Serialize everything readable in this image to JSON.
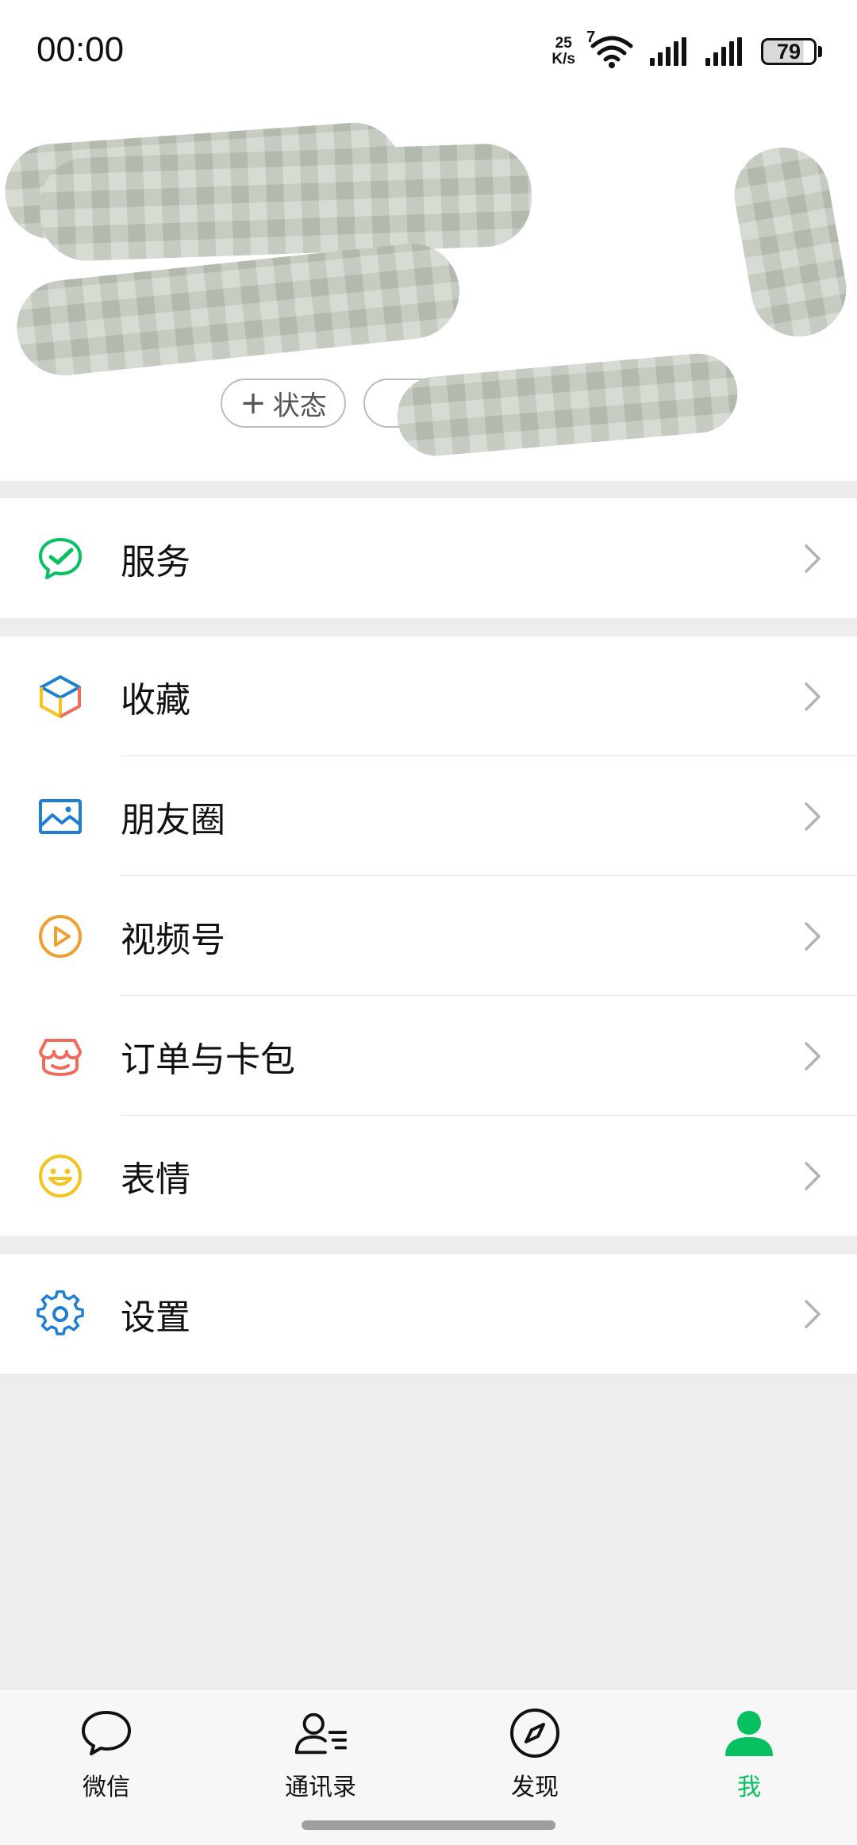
{
  "status_bar": {
    "time": "00:00",
    "net_speed_value": "25",
    "net_speed_unit": "K/s",
    "wifi_badge": "7",
    "battery_level": "79"
  },
  "profile": {
    "status_chip_label": "状态",
    "status_chip_icon": "plus-icon"
  },
  "menu": {
    "services": {
      "label": "服务",
      "icon": "services-icon",
      "color": "#07c160"
    },
    "favorites": {
      "label": "收藏",
      "icon": "cube-icon"
    },
    "moments": {
      "label": "朋友圈",
      "icon": "image-icon",
      "color": "#1d7fd3"
    },
    "channels": {
      "label": "视频号",
      "icon": "play-icon",
      "color": "#f0a030"
    },
    "orders_cards": {
      "label": "订单与卡包",
      "icon": "shop-icon",
      "color": "#f06b5b"
    },
    "stickers": {
      "label": "表情",
      "icon": "smile-icon",
      "color": "#f5c31c"
    },
    "settings": {
      "label": "设置",
      "icon": "gear-icon",
      "color": "#1d7fd3"
    }
  },
  "tabbar": {
    "tabs": [
      {
        "label": "微信",
        "icon": "chat-bubble-icon"
      },
      {
        "label": "通讯录",
        "icon": "contacts-icon"
      },
      {
        "label": "发现",
        "icon": "compass-icon"
      },
      {
        "label": "我",
        "icon": "person-icon"
      }
    ],
    "active_index": 3,
    "active_color": "#07c160"
  }
}
